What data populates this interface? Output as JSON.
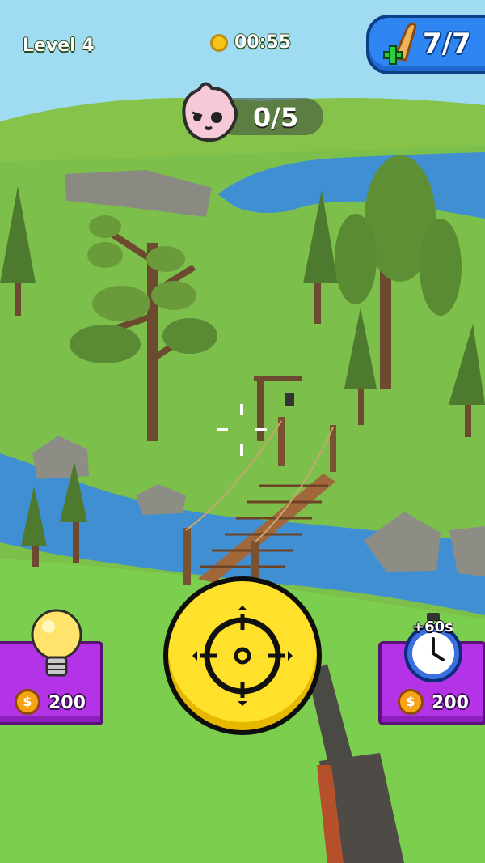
{
  "hud": {
    "level_label": "Level 4",
    "timer": "00:55",
    "ammo_count": "7/7",
    "targets_count": "0/5"
  },
  "powerups": {
    "hint": {
      "price": "200",
      "icon": "lightbulb-icon"
    },
    "extra_time": {
      "bonus_label": "+60s",
      "price": "200",
      "icon": "stopwatch-icon"
    }
  },
  "colors": {
    "ammo_panel": "#2f86f2",
    "shop_card": "#b533e6",
    "fire_button": "#ffe02a",
    "coin": "#f6a316"
  }
}
